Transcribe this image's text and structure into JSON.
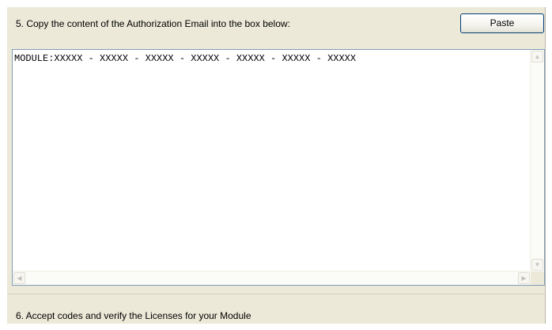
{
  "step5": {
    "label": "5. Copy the content of the Authorization Email into the box below:",
    "paste_button_label": "Paste",
    "textbox_value": "MODULE:XXXXX - XXXXX - XXXXX - XXXXX - XXXXX - XXXXX - XXXXX"
  },
  "scrollbars": {
    "up_arrow": "▲",
    "down_arrow": "▼",
    "left_arrow": "◀",
    "right_arrow": "▶"
  },
  "step6": {
    "label": "6. Accept codes and verify the Licenses for your Module"
  }
}
